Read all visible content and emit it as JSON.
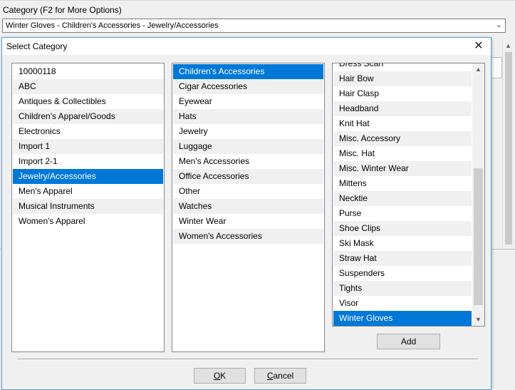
{
  "parent": {
    "category_label": "Category (F2 for More Options)",
    "category_value": "Winter Gloves - Children's Accessories - Jewelry/Accessories"
  },
  "dialog": {
    "title": "Select Category",
    "close_symbol": "✕",
    "list1": {
      "items": [
        "10000118",
        "ABC",
        "Antiques & Collectibles",
        "Children's Apparel/Goods",
        "Electronics",
        "Import 1",
        "Import 2-1",
        "Jewelry/Accessories",
        "Men's Apparel",
        "Musical Instruments",
        "Women's Apparel"
      ],
      "selected_index": 7
    },
    "list2": {
      "items": [
        "Children's Accessories",
        "Cigar Accessories",
        "Eyewear",
        "Hats",
        "Jewelry",
        "Luggage",
        "Men's Accessories",
        "Office Accessories",
        "Other",
        "Watches",
        "Winter Wear",
        "Women's Accessories"
      ],
      "selected_index": 0
    },
    "list3": {
      "items": [
        "Dress Scarf",
        "Hair Bow",
        "Hair Clasp",
        "Headband",
        "Knit Hat",
        "Misc. Accessory",
        "Misc. Hat",
        "Misc. Winter Wear",
        "Mittens",
        "Necktie",
        "Purse",
        "Shoe Clips",
        "Ski Mask",
        "Straw Hat",
        "Suspenders",
        "Tights",
        "Visor",
        "Winter Gloves"
      ],
      "selected_index": 17
    },
    "buttons": {
      "add": "Add",
      "ok_mnemonic": "O",
      "ok_rest": "K",
      "cancel_mnemonic": "C",
      "cancel_rest": "ancel"
    }
  },
  "icons": {
    "combo_arrow": "chevron-down-icon",
    "close": "close-icon",
    "scroll_up": "scroll-up-icon",
    "scroll_down": "scroll-down-icon"
  },
  "colors": {
    "selection": "#0078d7",
    "dialog_border": "#5b9bd5"
  }
}
